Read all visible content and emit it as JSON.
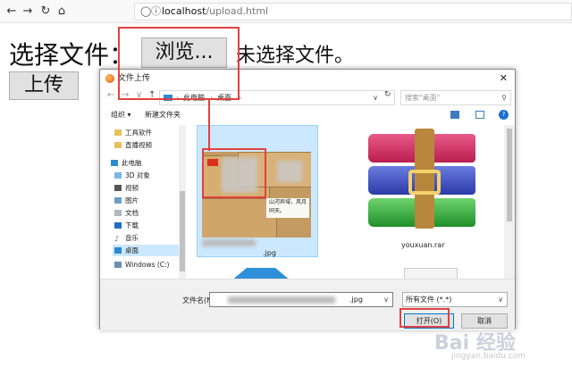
{
  "browser": {
    "back_icon": "arrow-left-icon",
    "forward_icon": "arrow-right-icon",
    "reload_icon": "reload-icon",
    "home_icon": "home-icon",
    "url_host": "localhost",
    "url_path": "/upload.html"
  },
  "page": {
    "select_file_label": "选择文件：",
    "browse_button": "浏览...",
    "no_file_text": "未选择文件。",
    "upload_button": "上传"
  },
  "dialog": {
    "title": "文件上传",
    "breadcrumb": [
      "此电脑",
      "桌面"
    ],
    "search_placeholder": "搜索\"桌面\"",
    "organize": "组织 ▾",
    "new_folder": "新建文件夹",
    "sidebar": [
      {
        "label": "工具软件",
        "icon": "folder-icon"
      },
      {
        "label": "直播视频",
        "icon": "folder-icon"
      },
      {
        "label": "此电脑",
        "icon": "computer-icon"
      },
      {
        "label": "3D 对象",
        "icon": "cube-icon"
      },
      {
        "label": "视频",
        "icon": "video-icon"
      },
      {
        "label": "图片",
        "icon": "picture-icon"
      },
      {
        "label": "文档",
        "icon": "document-icon"
      },
      {
        "label": "下载",
        "icon": "download-icon"
      },
      {
        "label": "音乐",
        "icon": "music-icon"
      },
      {
        "label": "桌面",
        "icon": "desktop-icon"
      },
      {
        "label": "Windows (C:)",
        "icon": "drive-icon"
      },
      {
        "label": "网络",
        "icon": "network-icon"
      }
    ],
    "files": [
      {
        "name_suffix": ".jpg",
        "note": "山河异域，风月同天。"
      },
      {
        "name": "youxuan.rar"
      }
    ],
    "filename_label": "文件名(N):",
    "filename_suffix": ".jpg",
    "filter": "所有文件 (*.*)",
    "open_button": "打开(O)",
    "cancel_button": "取消"
  },
  "watermark": {
    "brand": "Bai 经验",
    "url": "jingyan.baidu.com"
  },
  "colors": {
    "highlight": "#e34040",
    "selection": "#cce8ff"
  }
}
